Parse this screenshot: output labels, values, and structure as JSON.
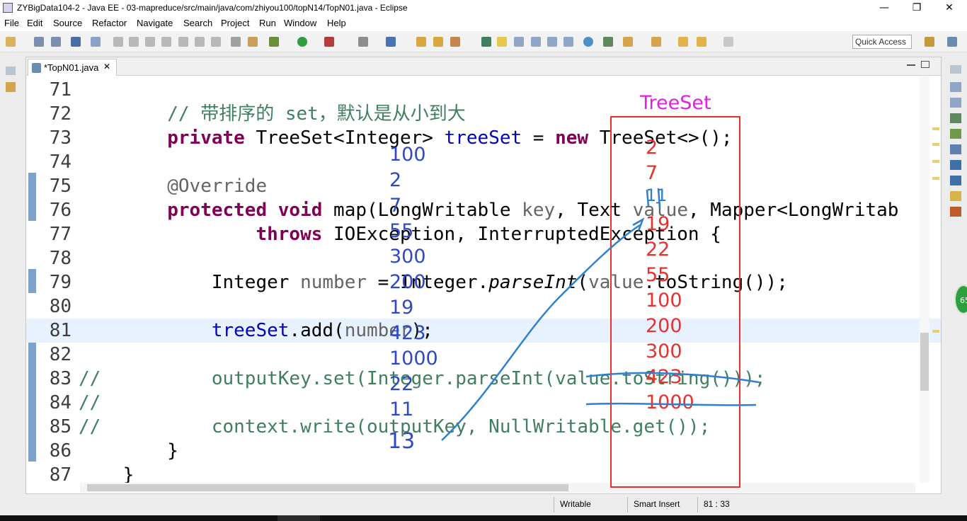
{
  "window": {
    "title": "ZYBigData104-2 - Java EE - 03-mapreduce/src/main/java/com/zhiyou100/topN14/TopN01.java - Eclipse",
    "minimize": "—",
    "restore": "❐",
    "close": "✕"
  },
  "menu": [
    "File",
    "Edit",
    "Source",
    "Refactor",
    "Navigate",
    "Search",
    "Project",
    "Run",
    "Window",
    "Help"
  ],
  "toolbar": {
    "quick_access": "Quick Access"
  },
  "editor": {
    "tab_label": "*TopN01.java",
    "tab_close": "✕",
    "lines": [
      {
        "n": "71",
        "parts": []
      },
      {
        "n": "72",
        "parts": [
          {
            "t": "        "
          },
          {
            "c": "cm",
            "t": "// 带排序的 set，默认是从小到大"
          }
        ]
      },
      {
        "n": "73",
        "parts": [
          {
            "t": "        "
          },
          {
            "c": "kw",
            "t": "private"
          },
          {
            "t": " TreeSet<Integer> "
          },
          {
            "c": "fd",
            "t": "treeSet"
          },
          {
            "t": " = "
          },
          {
            "c": "kw",
            "t": "new"
          },
          {
            "t": " TreeSet<>();"
          }
        ]
      },
      {
        "n": "74",
        "parts": []
      },
      {
        "n": "75",
        "parts": [
          {
            "t": "        "
          },
          {
            "c": "an",
            "t": "@Override"
          }
        ]
      },
      {
        "n": "76",
        "parts": [
          {
            "t": "        "
          },
          {
            "c": "kw",
            "t": "protected"
          },
          {
            "t": " "
          },
          {
            "c": "kw",
            "t": "void"
          },
          {
            "t": " map(LongWritable "
          },
          {
            "c": "an",
            "t": "key"
          },
          {
            "t": ", Text "
          },
          {
            "c": "an",
            "t": "value"
          },
          {
            "t": ", Mapper<LongWritab"
          }
        ]
      },
      {
        "n": "77",
        "parts": [
          {
            "t": "                "
          },
          {
            "c": "kw",
            "t": "throws"
          },
          {
            "t": " IOException, InterruptedException {"
          }
        ]
      },
      {
        "n": "78",
        "parts": []
      },
      {
        "n": "79",
        "parts": [
          {
            "t": "            Integer "
          },
          {
            "c": "an",
            "t": "number"
          },
          {
            "t": " = Integer."
          },
          {
            "c": "it",
            "t": "parseInt"
          },
          {
            "t": "("
          },
          {
            "c": "an",
            "t": "value"
          },
          {
            "t": ".toString());"
          }
        ]
      },
      {
        "n": "80",
        "parts": []
      },
      {
        "n": "81",
        "parts": [
          {
            "t": "            "
          },
          {
            "c": "fd",
            "t": "treeSet"
          },
          {
            "t": ".add("
          },
          {
            "c": "an",
            "t": "number"
          },
          {
            "t": ");"
          }
        ]
      },
      {
        "n": "82",
        "parts": []
      },
      {
        "n": "83",
        "parts": [
          {
            "c": "cm",
            "t": "//          outputKey.set(Integer.parseInt(value.toString()));"
          }
        ]
      },
      {
        "n": "84",
        "parts": [
          {
            "c": "cm",
            "t": "//"
          }
        ]
      },
      {
        "n": "85",
        "parts": [
          {
            "c": "cm",
            "t": "//          context.write(outputKey, NullWritable.get());"
          }
        ]
      },
      {
        "n": "86",
        "parts": [
          {
            "t": "        }"
          }
        ]
      },
      {
        "n": "87",
        "parts": [
          {
            "t": "    }"
          }
        ]
      }
    ]
  },
  "annotations": {
    "treeset_label": "TreeSet",
    "input_values": [
      "100",
      "2",
      "7",
      "55",
      "300",
      "200",
      "19",
      "423",
      "1000",
      "22",
      "11"
    ],
    "handwritten_13": "13",
    "sorted_values": [
      "2",
      "7",
      "11",
      "19",
      "22",
      "55",
      "100",
      "200",
      "300",
      "423",
      "1000"
    ],
    "bubble_text": "65"
  },
  "status": {
    "writable": "Writable",
    "insert_mode": "Smart Insert",
    "position": "81 : 33"
  }
}
